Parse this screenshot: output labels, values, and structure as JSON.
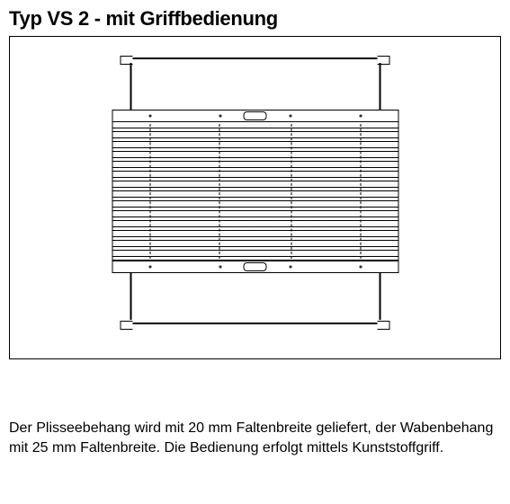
{
  "title": "Typ VS 2 - mit Griffbedienung",
  "description": "Der Plisseebehang wird mit 20 mm Faltenbreite geliefert, der Wabenbehang mit 25 mm Faltenbreite. Die Bedienung erfolgt mittels Kunststoffgriff."
}
